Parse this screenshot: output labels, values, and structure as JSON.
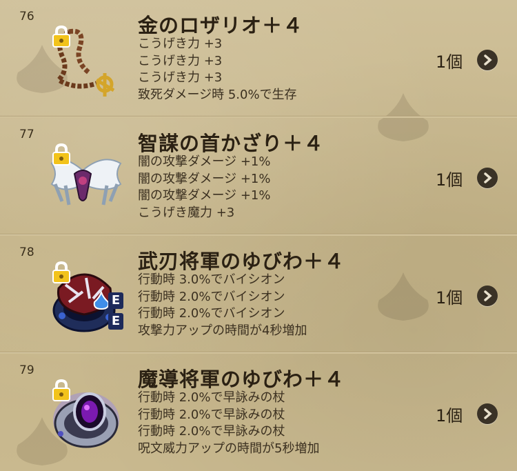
{
  "items": [
    {
      "number": "76",
      "name": "金のロザリオ＋４",
      "stats": [
        "こうげき力 +3",
        "こうげき力 +3",
        "こうげき力 +3",
        "致死ダメージ時 5.0%で生存"
      ],
      "count": "1個",
      "icon": "gold-rosary-icon"
    },
    {
      "number": "77",
      "name": "智謀の首かざり＋４",
      "stats": [
        "闇の攻撃ダメージ +1%",
        "闇の攻撃ダメージ +1%",
        "闇の攻撃ダメージ +1%",
        "こうげき魔力 +3"
      ],
      "count": "1個",
      "icon": "winged-necklace-icon"
    },
    {
      "number": "78",
      "name": "武刃将軍のゆびわ＋４",
      "stats": [
        "行動時 3.0%でバイシオン",
        "行動時 2.0%でバイシオン",
        "行動時 2.0%でバイシオン",
        "攻撃力アップの時間が4秒増加"
      ],
      "count": "1個",
      "icon": "red-ring-icon",
      "badge": "E"
    },
    {
      "number": "79",
      "name": "魔導将軍のゆびわ＋４",
      "stats": [
        "行動時 2.0%で早詠みの杖",
        "行動時 2.0%で早詠みの杖",
        "行動時 2.0%で早詠みの杖",
        "呪文威力アップの時間が5秒増加"
      ],
      "count": "1個",
      "icon": "purple-ring-icon"
    }
  ],
  "colors": {
    "text": "#2b2113",
    "background": "#c8b88f",
    "lock": "#f2c31b"
  }
}
